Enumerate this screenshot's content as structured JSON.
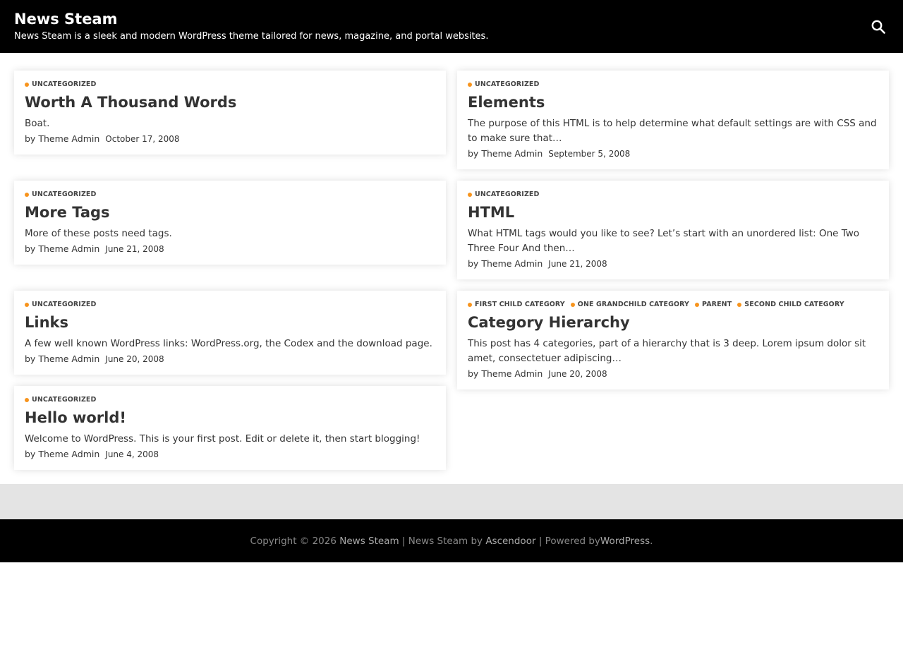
{
  "site": {
    "title": "News Steam",
    "tagline": "News Steam is a sleek and modern WordPress theme tailored for news, magazine, and portal websites."
  },
  "accent_color": "#f7941d",
  "search_icon": "search-icon",
  "posts_left": [
    {
      "categories": [
        "UNCATEGORIZED"
      ],
      "title": "Worth A Thousand Words",
      "excerpt": "Boat.",
      "by": "by",
      "author": "Theme Admin",
      "date": "October 17, 2008"
    },
    {
      "categories": [
        "UNCATEGORIZED"
      ],
      "title": "More Tags",
      "excerpt": "More of these posts need tags.",
      "by": "by",
      "author": "Theme Admin",
      "date": "June 21, 2008"
    },
    {
      "categories": [
        "UNCATEGORIZED"
      ],
      "title": "Links",
      "excerpt": "A few well known WordPress links: WordPress.org, the Codex and the download page.",
      "by": "by",
      "author": "Theme Admin",
      "date": "June 20, 2008"
    },
    {
      "categories": [
        "UNCATEGORIZED"
      ],
      "title": "Hello world!",
      "excerpt": "Welcome to WordPress. This is your first post. Edit or delete it, then start blogging!",
      "by": "by",
      "author": "Theme Admin",
      "date": "June 4, 2008"
    }
  ],
  "posts_right": [
    {
      "categories": [
        "UNCATEGORIZED"
      ],
      "title": "Elements",
      "excerpt": "The purpose of this HTML is to help determine what default settings are with CSS and to make sure that…",
      "by": "by",
      "author": "Theme Admin",
      "date": "September 5, 2008"
    },
    {
      "categories": [
        "UNCATEGORIZED"
      ],
      "title": "HTML",
      "excerpt": "What HTML tags would you like to see? Let’s start with an unordered list: One Two Three Four And then…",
      "by": "by",
      "author": "Theme Admin",
      "date": "June 21, 2008"
    },
    {
      "categories": [
        "FIRST CHILD CATEGORY",
        "ONE GRANDCHILD CATEGORY",
        "PARENT",
        "SECOND CHILD CATEGORY"
      ],
      "title": "Category Hierarchy",
      "excerpt": "This post has 4 categories, part of a hierarchy that is 3 deep. Lorem ipsum dolor sit amet, consectetuer adipiscing…",
      "by": "by",
      "author": "Theme Admin",
      "date": "June 20, 2008"
    }
  ],
  "footer": {
    "copyright_prefix": "Copyright © 2026",
    "site_link": "News Steam",
    "sep1": "|",
    "theme_link": "News Steam",
    "by_word": "by",
    "author_link": "Ascendoor",
    "sep2": "|",
    "powered_by": "Powered by",
    "wp_link": "WordPress",
    "period": "."
  }
}
